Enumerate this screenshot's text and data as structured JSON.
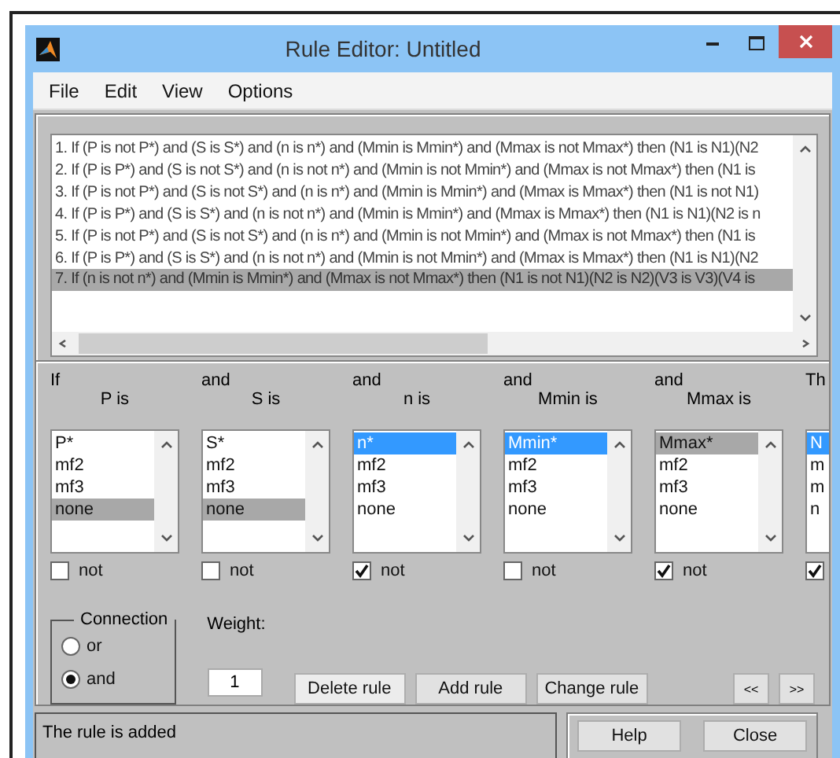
{
  "window": {
    "title": "Rule Editor: Untitled"
  },
  "menu": [
    "File",
    "Edit",
    "View",
    "Options"
  ],
  "rules": [
    {
      "text": "1. If (P is not P*) and (S is S*) and (n is n*) and (Mmin is Mmin*) and (Mmax is not Mmax*) then (N1 is N1)(N2",
      "selected": false
    },
    {
      "text": "2. If (P is P*) and (S is not S*) and (n is not n*) and (Mmin is not Mmin*) and (Mmax is not Mmax*) then (N1 is",
      "selected": false
    },
    {
      "text": "3. If (P is not P*) and (S is not S*) and (n is n*) and (Mmin is Mmin*) and (Mmax is Mmax*) then (N1 is not N1)",
      "selected": false
    },
    {
      "text": "4. If (P is P*) and (S is S*) and (n is not n*) and (Mmin is Mmin*) and (Mmax is Mmax*) then (N1 is N1)(N2 is n",
      "selected": false
    },
    {
      "text": "5. If (P is not P*) and (S is not S*) and (n is n*) and (Mmin is not Mmin*) and (Mmax is not Mmax*) then (N1 is",
      "selected": false
    },
    {
      "text": "6. If (P is P*) and (S is S*) and (n is not n*) and (Mmin is not Mmin*) and (Mmax is Mmax*) then (N1 is N1)(N2",
      "selected": false
    },
    {
      "text": "7. If (n is not n*) and (Mmin is Mmin*) and (Mmax is not Mmax*) then (N1 is not N1)(N2 is N2)(V3 is V3)(V4 is",
      "selected": true
    }
  ],
  "variables": [
    {
      "connector": "If",
      "label": "P is",
      "focused": false,
      "not": false,
      "items": [
        {
          "label": "P*",
          "selected": false
        },
        {
          "label": "mf2",
          "selected": false
        },
        {
          "label": "mf3",
          "selected": false
        },
        {
          "label": "none",
          "selected": true
        }
      ]
    },
    {
      "connector": "and",
      "label": "S is",
      "focused": false,
      "not": false,
      "items": [
        {
          "label": "S*",
          "selected": false
        },
        {
          "label": "mf2",
          "selected": false
        },
        {
          "label": "mf3",
          "selected": false
        },
        {
          "label": "none",
          "selected": true
        }
      ]
    },
    {
      "connector": "and",
      "label": "n is",
      "focused": true,
      "not": true,
      "items": [
        {
          "label": "n*",
          "selected": true
        },
        {
          "label": "mf2",
          "selected": false
        },
        {
          "label": "mf3",
          "selected": false
        },
        {
          "label": "none",
          "selected": false
        }
      ]
    },
    {
      "connector": "and",
      "label": "Mmin is",
      "focused": true,
      "not": false,
      "items": [
        {
          "label": "Mmin*",
          "selected": true
        },
        {
          "label": "mf2",
          "selected": false
        },
        {
          "label": "mf3",
          "selected": false
        },
        {
          "label": "none",
          "selected": false
        }
      ]
    },
    {
      "connector": "and",
      "label": "Mmax is",
      "focused": false,
      "not": true,
      "items": [
        {
          "label": "Mmax*",
          "selected": true
        },
        {
          "label": "mf2",
          "selected": false
        },
        {
          "label": "mf3",
          "selected": false
        },
        {
          "label": "none",
          "selected": false
        }
      ]
    },
    {
      "connector": "Th",
      "focused": true,
      "not": true,
      "items": [
        {
          "label": "N",
          "selected": true
        },
        {
          "label": "m",
          "selected": false
        },
        {
          "label": "m",
          "selected": false
        },
        {
          "label": "n",
          "selected": false
        }
      ]
    }
  ],
  "connection": {
    "title": "Connection",
    "options": [
      {
        "label": "or",
        "selected": false
      },
      {
        "label": "and",
        "selected": true
      }
    ]
  },
  "not_labels": [
    "not",
    "not",
    "not",
    "not",
    "not"
  ],
  "weight": {
    "label": "Weight:",
    "value": "1"
  },
  "rule_buttons": [
    "Delete rule",
    "Add rule",
    "Change rule"
  ],
  "nav_buttons": [
    "<<",
    ">>"
  ],
  "status": "The rule is added",
  "dialog_buttons": [
    "Help",
    "Close"
  ]
}
